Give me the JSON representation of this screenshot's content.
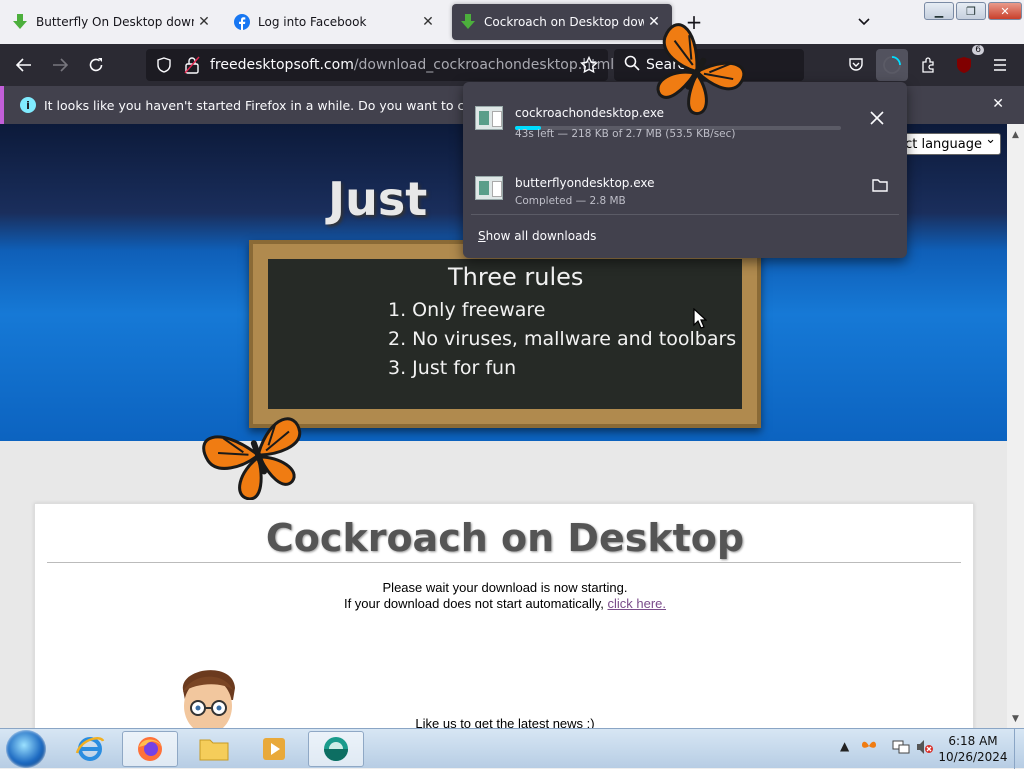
{
  "tabs": [
    {
      "title": "Butterfly On Desktop download",
      "icon": "download-arrow-icon",
      "active": false
    },
    {
      "title": "Log into Facebook",
      "icon": "facebook-icon",
      "active": false
    },
    {
      "title": "Cockroach on Desktop download",
      "icon": "download-arrow-icon",
      "active": true
    }
  ],
  "toolbar": {
    "url_domain": "freedesktopsoft.com",
    "url_path": "/download_cockroachondesktop.html",
    "search_placeholder": "Search",
    "extension_badge": "6"
  },
  "notification": {
    "text": "It looks like you haven't started Firefox in a while. Do you want to clean it up for"
  },
  "downloads": {
    "items": [
      {
        "name": "cockroachondesktop.exe",
        "status": "43s left — 218 KB of 2.7 MB (53.5 KB/sec)",
        "progress": 0.08,
        "action_icon": "close-icon"
      },
      {
        "name": "butterflyondesktop.exe",
        "status": "Completed — 2.8 MB",
        "action_icon": "folder-icon"
      }
    ],
    "show_all_label": "Show all downloads"
  },
  "page": {
    "banner_title": "Just",
    "language_select": "ect language",
    "chalkboard": {
      "title": "Three rules",
      "rules": [
        "1. Only freeware",
        "2. No viruses, mallware and toolbars",
        "3. Just for fun"
      ]
    },
    "content_title": "Cockroach on Desktop",
    "wait_message": "Please wait your download is now starting.",
    "fallback_message": "If your download does not start automatically,",
    "click_here_label": "click here.",
    "like_message": "Like us to get the latest news :)"
  },
  "taskbar": {
    "time": "6:18 AM",
    "date": "10/26/2024"
  },
  "colors": {
    "accent": "#00ddff",
    "notification_stripe": "#c25fd9",
    "toolbar_bg": "#2b2a33",
    "panel_bg": "#42414d"
  }
}
